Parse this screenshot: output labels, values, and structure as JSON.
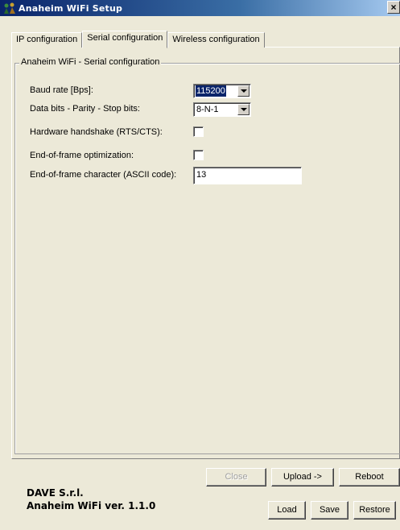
{
  "window": {
    "title": "Anaheim WiFi Setup",
    "close_glyph": "×"
  },
  "tabs": [
    {
      "label": "IP configuration",
      "active": false
    },
    {
      "label": "Serial configuration",
      "active": true
    },
    {
      "label": "Wireless configuration",
      "active": false
    }
  ],
  "group": {
    "title": "Anaheim WiFi - Serial configuration"
  },
  "fields": {
    "baud_rate": {
      "label": "Baud rate [Bps]:",
      "value": "115200"
    },
    "data_bits": {
      "label": "Data bits - Parity - Stop bits:",
      "value": "8-N-1"
    },
    "handshake": {
      "label": "Hardware handshake (RTS/CTS):",
      "checked": false
    },
    "eof_opt": {
      "label": "End-of-frame optimization:",
      "checked": false
    },
    "eof_char": {
      "label": "End-of-frame character (ASCII code):",
      "value": "13"
    }
  },
  "buttons": {
    "close": "Close",
    "upload": "Upload ->",
    "reboot": "Reboot",
    "load": "Load",
    "save": "Save",
    "restore": "Restore"
  },
  "footer": {
    "company": "DAVE S.r.l.",
    "version": "Anaheim WiFi ver. 1.1.0"
  },
  "colors": {
    "title_bar_start": "#0a246a",
    "title_bar_end": "#a6caf0",
    "dialog_bg": "#ece9d8",
    "selection": "#0a246a"
  }
}
